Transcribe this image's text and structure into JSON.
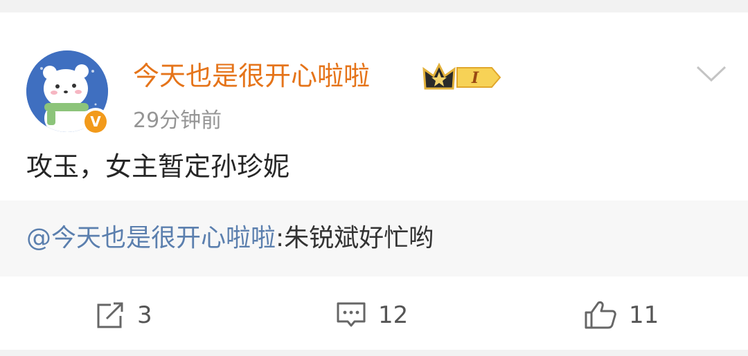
{
  "post": {
    "username": "今天也是很开心啦啦",
    "level_badge": "I",
    "time": "29分钟前",
    "text": "攻玉，女主暂定孙珍妮",
    "verified_mark": "V"
  },
  "quote": {
    "mention": "@今天也是很开心啦啦",
    "text": ":朱锐斌好忙哟"
  },
  "actions": {
    "repost_count": "3",
    "comment_count": "12",
    "like_count": "11"
  },
  "colors": {
    "username": "#e5741a",
    "mention": "#5b7fae",
    "verified": "#f29a1b",
    "avatar_bg": "#3f6fc0"
  },
  "icons": {
    "more": "chevron-down-icon",
    "repost": "repost-icon",
    "comment": "comment-icon",
    "like": "thumbs-up-icon"
  }
}
